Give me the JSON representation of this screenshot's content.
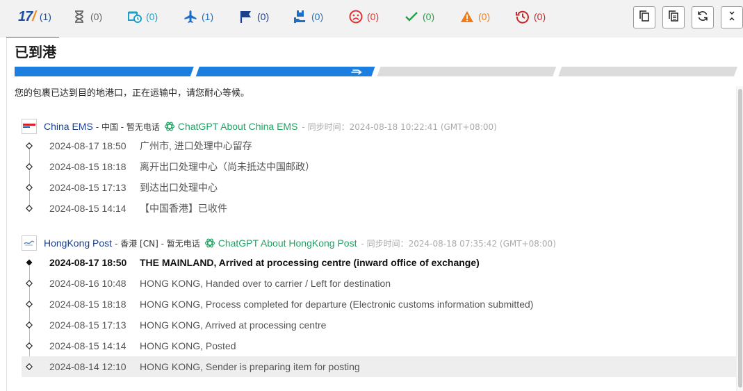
{
  "tabs": [
    {
      "id": "all",
      "icon": "logo-17-icon",
      "count": "(1)",
      "color": "#1c4f9c",
      "active": true
    },
    {
      "id": "not-found",
      "icon": "hourglass-icon",
      "count": "(0)",
      "color": "#666666"
    },
    {
      "id": "info-received",
      "icon": "truck-clock-icon",
      "count": "(0)",
      "color": "#1aa0c8"
    },
    {
      "id": "in-transit",
      "icon": "airplane-icon",
      "count": "(1)",
      "color": "#1c6fc6"
    },
    {
      "id": "expired",
      "icon": "flag-icon",
      "count": "(0)",
      "color": "#1b3f8b"
    },
    {
      "id": "pickup",
      "icon": "parcel-hand-icon",
      "count": "(0)",
      "color": "#1c6fc6"
    },
    {
      "id": "undelivered",
      "icon": "sad-face-icon",
      "count": "(0)",
      "color": "#e0342f"
    },
    {
      "id": "delivered",
      "icon": "checkmark-icon",
      "count": "(0)",
      "color": "#24a148"
    },
    {
      "id": "alert",
      "icon": "warning-icon",
      "count": "(0)",
      "color": "#f07b1c"
    },
    {
      "id": "returned",
      "icon": "history-icon",
      "count": "(0)",
      "color": "#c62828"
    }
  ],
  "tools": [
    {
      "icon": "copy-icon"
    },
    {
      "icon": "copy-all-icon"
    },
    {
      "icon": "refresh-icon"
    },
    {
      "icon": "collapse-icon"
    }
  ],
  "status": {
    "title": "已到港",
    "description": "您的包裹已达到目的地港口，正在运输中，请您耐心等候。",
    "progress": [
      1,
      1,
      0,
      0
    ],
    "accent": "#1c7fe0"
  },
  "carriers": [
    {
      "name": "China EMS",
      "meta": "- 中国 - 暂无电话",
      "gpt_label": "ChatGPT About China EMS",
      "sync": "- 同步时间：2024-08-18 10:22:41 (GMT+08:00)",
      "events": [
        {
          "time": "2024-08-17 18:50",
          "text": "广州市, 进口处理中心留存"
        },
        {
          "time": "2024-08-15 18:18",
          "text": "离开出口处理中心（尚未抵达中国邮政）"
        },
        {
          "time": "2024-08-15 17:13",
          "text": "到达出口处理中心"
        },
        {
          "time": "2024-08-15 14:14",
          "text": "【中国香港】已收件"
        }
      ]
    },
    {
      "name": "HongKong Post",
      "meta": "- 香港 [CN] - 暂无电话",
      "gpt_label": "ChatGPT About HongKong Post",
      "sync": "- 同步时间：2024-08-18 07:35:42 (GMT+08:00)",
      "events": [
        {
          "time": "2024-08-17 18:50",
          "text": "THE MAINLAND, Arrived at processing centre (inward office of exchange)"
        },
        {
          "time": "2024-08-16 10:48",
          "text": "HONG KONG, Handed over to carrier / Left for destination"
        },
        {
          "time": "2024-08-15 18:18",
          "text": "HONG KONG, Process completed for departure (Electronic customs information submitted)"
        },
        {
          "time": "2024-08-15 17:13",
          "text": "HONG KONG, Arrived at processing centre"
        },
        {
          "time": "2024-08-15 14:14",
          "text": "HONG KONG, Posted"
        },
        {
          "time": "2024-08-14 12:10",
          "text": "HONG KONG, Sender is preparing item for posting"
        }
      ]
    }
  ]
}
